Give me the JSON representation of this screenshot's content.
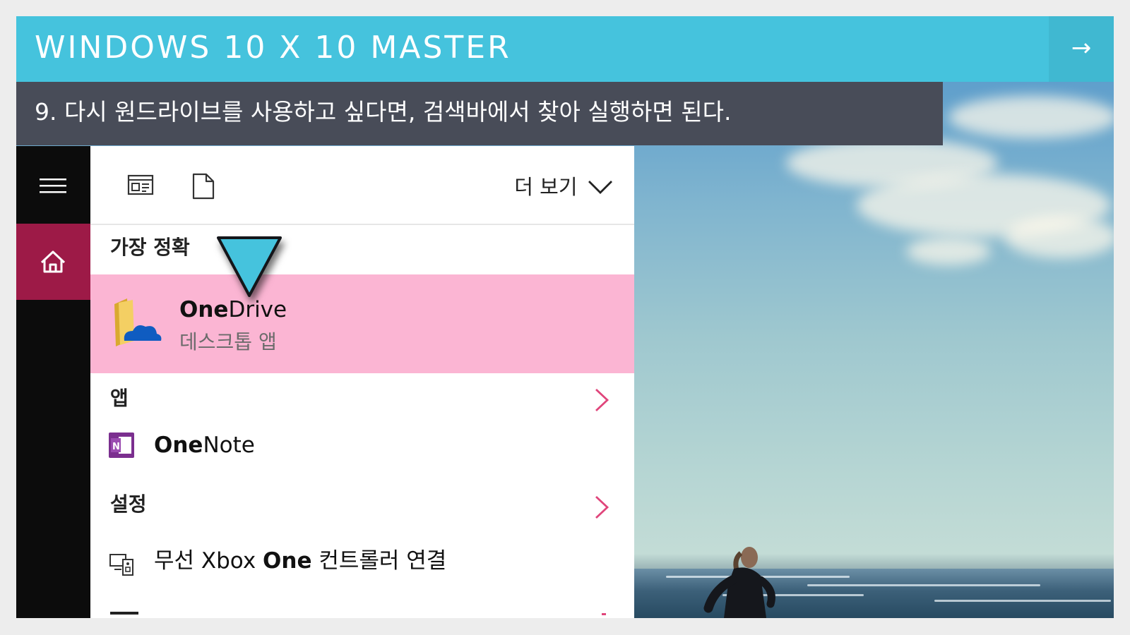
{
  "header": {
    "title": "WINDOWS 10 X 10 MASTER",
    "next_glyph": "→",
    "accent": "#45c3dd"
  },
  "caption": {
    "text": "9. 다시 원드라이브를 사용하고 싶다면, 검색바에서 찾아 실행하면 된다."
  },
  "rail": {
    "menu_icon": "hamburger-icon",
    "home_icon": "home-icon",
    "home_color": "#9d1a47"
  },
  "toolbar": {
    "icons": [
      "web-preview-icon",
      "document-icon"
    ],
    "more_label": "더 보기",
    "more_icon": "chevron-down-icon"
  },
  "results": {
    "best_match_header": "가장 정확",
    "best_match": {
      "name_bold": "One",
      "name_rest": "Drive",
      "subtitle": "데스크톱 앱",
      "icon": "onedrive-folder-icon",
      "highlight": "#fbb5d3"
    },
    "apps_header": "앱",
    "apps": [
      {
        "name_bold": "One",
        "name_rest": "Note",
        "icon": "onenote-icon"
      }
    ],
    "settings_header": "설정",
    "settings": [
      {
        "prefix": "무선 Xbox ",
        "bold": "One",
        "suffix": " 컨트롤러 연결",
        "icon": "devices-icon"
      }
    ],
    "section_chevron_color": "#e0457b"
  },
  "annotation": {
    "marker_icon": "pointer-triangle-icon",
    "marker_color": "#45c3dd"
  }
}
